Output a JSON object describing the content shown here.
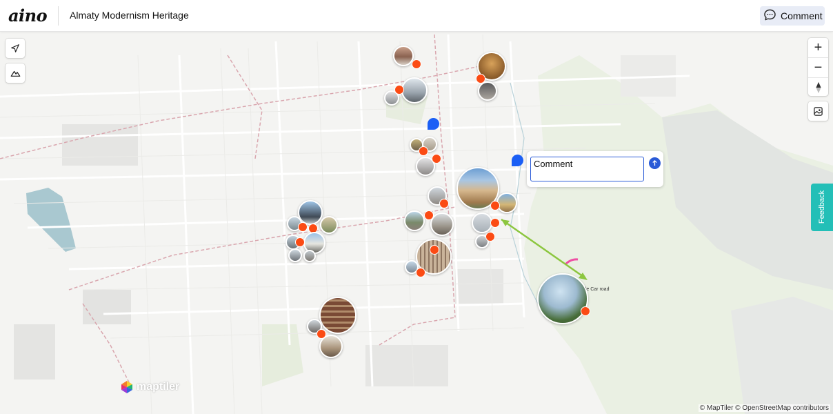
{
  "app": {
    "logo": "aino",
    "title": "Almaty Modernism Heritage",
    "comment_button_label": "Comment",
    "comment_icon": "chat-bubble-icon"
  },
  "map_controls": {
    "left": [
      {
        "name": "locate-icon"
      },
      {
        "name": "terrain-icon"
      }
    ],
    "right": {
      "zoom_in": "+",
      "zoom_out": "−",
      "compass": "compass-icon",
      "style_switch": "map-style-icon"
    }
  },
  "comment_popup": {
    "placeholder": "Comment",
    "send_icon": "arrow-up-icon"
  },
  "feedback_tab": "Feedback",
  "road_label": "Cable Car road",
  "maptiler_logo": "maptiler",
  "attribution": "© MapTiler © OpenStreetMap contributors",
  "colors": {
    "marker": "#fb4b14",
    "comment_pin": "#1b5ff5",
    "feedback_tab": "#23bfb7",
    "arrow": "#8cc63f",
    "accent": "#2a5bd7"
  }
}
